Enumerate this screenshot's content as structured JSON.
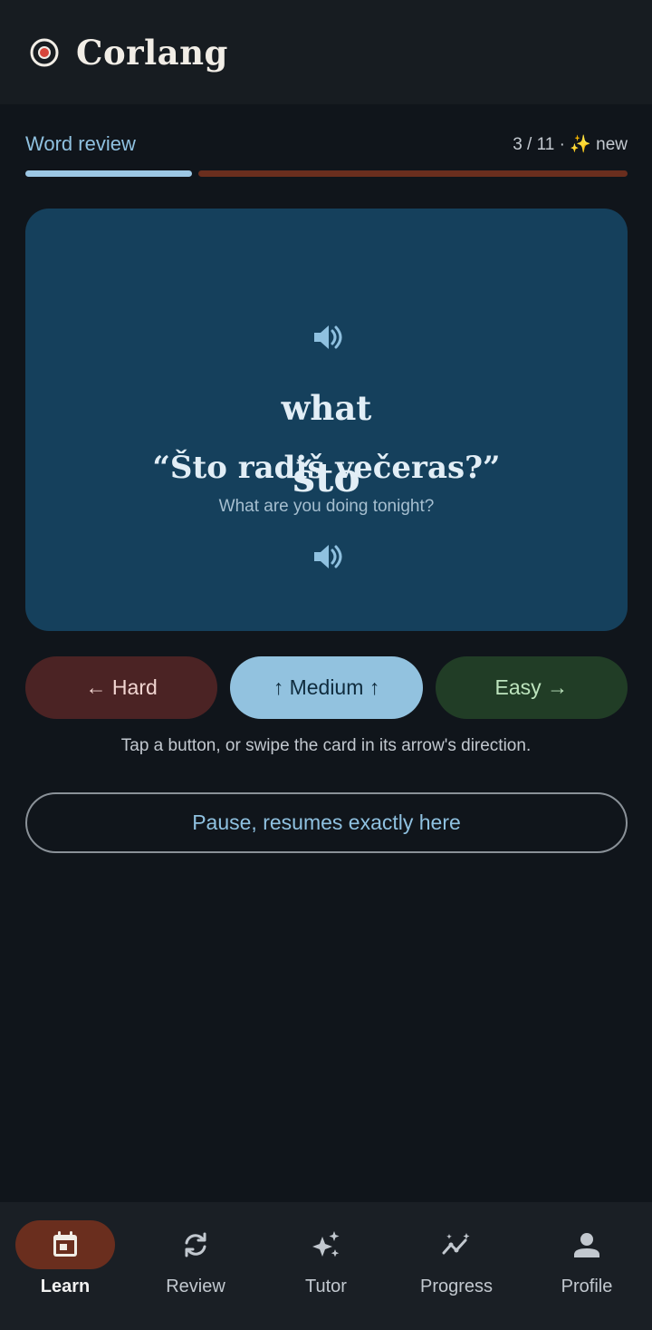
{
  "app": {
    "title": "Corlang"
  },
  "review": {
    "label": "Word review",
    "count": "3 / 11 · ✨ new",
    "progress_fraction": 0.28
  },
  "card": {
    "word": "što",
    "translation": "what",
    "sentence": "“Što radiš večeras?”",
    "sentence_translation": "What are you doing tonight?"
  },
  "buttons": {
    "hard": "← Hard",
    "medium": "↑ Medium ↑",
    "easy": "Easy →"
  },
  "hint": "Tap a button, or swipe the card in its arrow's direction.",
  "pause": "Pause, resumes exactly here",
  "nav": {
    "items": [
      {
        "label": "Learn",
        "icon": "calendar-icon",
        "active": true
      },
      {
        "label": "Review",
        "icon": "refresh-icon",
        "active": false
      },
      {
        "label": "Tutor",
        "icon": "sparkle-icon",
        "active": false
      },
      {
        "label": "Progress",
        "icon": "trend-icon",
        "active": false
      },
      {
        "label": "Profile",
        "icon": "person-icon",
        "active": false
      }
    ]
  },
  "colors": {
    "accent": "#8fc1e0",
    "card": "#15405c",
    "progress_rest": "#6a2e1e"
  }
}
